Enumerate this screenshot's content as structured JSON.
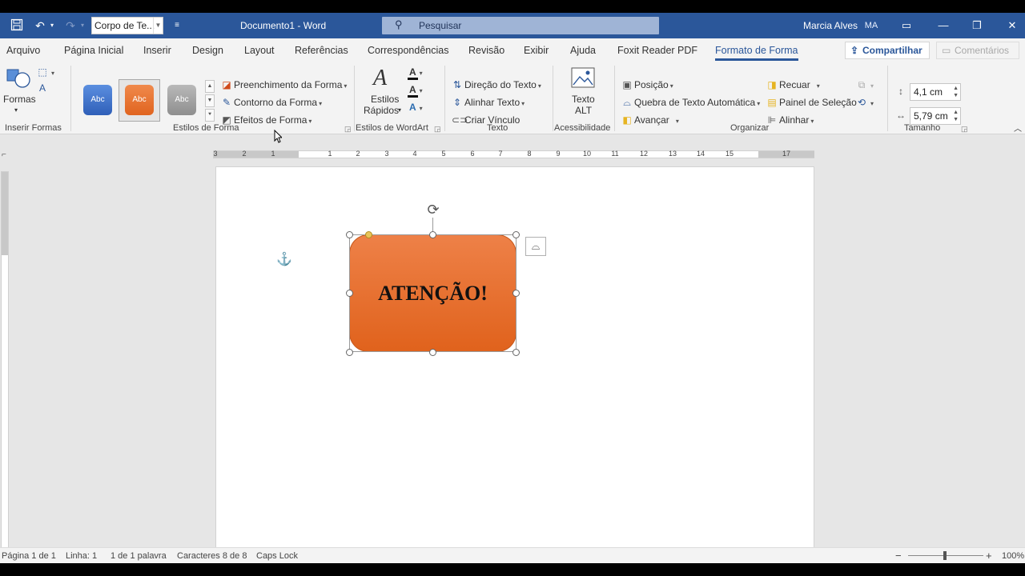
{
  "titlebar": {
    "style_box": "Corpo de Te...",
    "doc_title": "Documento1  -  Word",
    "search_placeholder": "Pesquisar",
    "user_name": "Marcia Alves",
    "user_initials": "MA"
  },
  "tabs": {
    "items": [
      "Arquivo",
      "Página Inicial",
      "Inserir",
      "Design",
      "Layout",
      "Referências",
      "Correspondências",
      "Revisão",
      "Exibir",
      "Ajuda",
      "Foxit Reader PDF",
      "Formato de Forma"
    ],
    "active": "Formato de Forma",
    "share": "Compartilhar",
    "comments": "Comentários"
  },
  "ribbon": {
    "insert_shapes": {
      "shapes_label": "Formas",
      "group": "Inserir Formas"
    },
    "shape_styles": {
      "thumb_label": "Abc",
      "fill": "Preenchimento da Forma",
      "outline": "Contorno da Forma",
      "effects": "Efeitos de Forma",
      "group": "Estilos de Forma"
    },
    "wordart": {
      "quick_styles_1": "Estilos",
      "quick_styles_2": "Rápidos",
      "group": "Estilos de WordArt"
    },
    "text": {
      "direction": "Direção do Texto",
      "align": "Alinhar Texto",
      "link": "Criar Vínculo",
      "group": "Texto"
    },
    "accessibility": {
      "alt_1": "Texto",
      "alt_2": "ALT",
      "group": "Acessibilidade"
    },
    "arrange": {
      "position": "Posição",
      "wrap": "Quebra de Texto Automática",
      "forward": "Avançar",
      "backward": "Recuar",
      "selection_pane": "Painel de Seleção",
      "align": "Alinhar",
      "group": "Organizar"
    },
    "size": {
      "height": "4,1 cm",
      "width": "5,79 cm",
      "group": "Tamanho"
    }
  },
  "ruler": {
    "numbers": [
      "3",
      "2",
      "1",
      "1",
      "2",
      "3",
      "4",
      "5",
      "6",
      "7",
      "8",
      "9",
      "10",
      "11",
      "12",
      "13",
      "14",
      "15",
      "17"
    ]
  },
  "document": {
    "shape_text": "ATENÇÃO!"
  },
  "statusbar": {
    "page": "Página 1 de 1",
    "line": "Linha: 1",
    "words": "1 de 1 palavra",
    "chars": "Caracteres 8 de 8",
    "caps": "Caps Lock",
    "zoom": "100%",
    "zoom_level": 1.0
  },
  "colors": {
    "brand": "#2b579a",
    "shape_fill": "#e8702f"
  }
}
